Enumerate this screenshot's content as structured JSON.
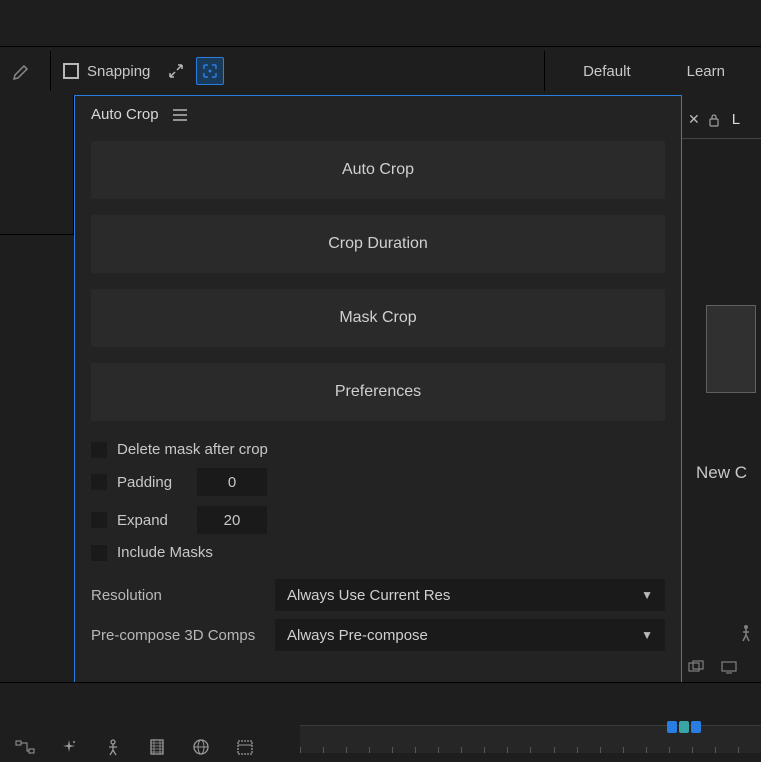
{
  "toolbar": {
    "snapping_label": "Snapping"
  },
  "workspace": {
    "tab_default": "Default",
    "tab_learn": "Learn"
  },
  "panel": {
    "title": "Auto Crop",
    "btn_autocrop": "Auto Crop",
    "btn_cropduration": "Crop Duration",
    "btn_maskcrop": "Mask Crop",
    "btn_preferences": "Preferences",
    "chk_deletemask": "Delete mask after crop",
    "chk_padding": "Padding",
    "padding_value": "0",
    "chk_expand": "Expand",
    "expand_value": "20",
    "chk_includemasks": "Include Masks",
    "resolution_label": "Resolution",
    "resolution_value": "Always Use Current Res",
    "precompose_label": "Pre-compose 3D Comps",
    "precompose_value": "Always Pre-compose"
  },
  "right": {
    "tab_letter": "L",
    "new_label": "New C"
  },
  "icons": {
    "pen": "pen-tool-icon",
    "rect": "rectangle-icon",
    "collapse": "collapse-icon",
    "brackets": "snap-brackets-icon",
    "menu": "hamburger-icon",
    "chevron": "chevron-down-icon"
  }
}
